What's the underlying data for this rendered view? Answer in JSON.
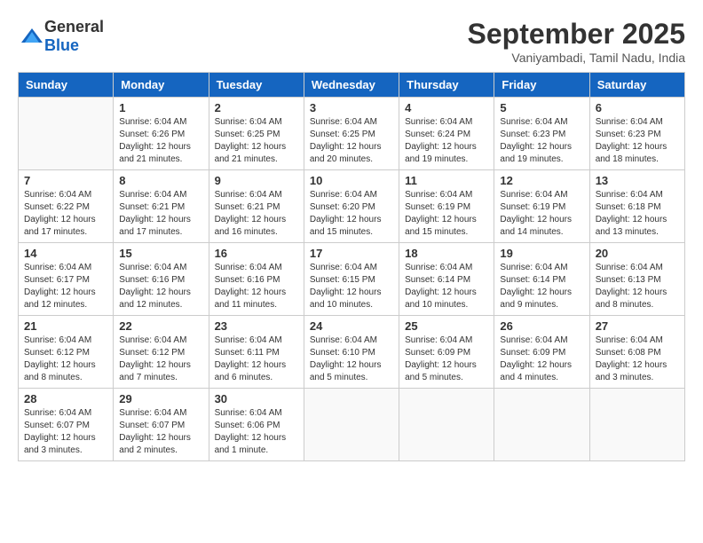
{
  "header": {
    "logo_general": "General",
    "logo_blue": "Blue",
    "month_title": "September 2025",
    "subtitle": "Vaniyambadi, Tamil Nadu, India"
  },
  "calendar": {
    "days_of_week": [
      "Sunday",
      "Monday",
      "Tuesday",
      "Wednesday",
      "Thursday",
      "Friday",
      "Saturday"
    ],
    "weeks": [
      [
        {
          "day": "",
          "info": ""
        },
        {
          "day": "1",
          "info": "Sunrise: 6:04 AM\nSunset: 6:26 PM\nDaylight: 12 hours\nand 21 minutes."
        },
        {
          "day": "2",
          "info": "Sunrise: 6:04 AM\nSunset: 6:25 PM\nDaylight: 12 hours\nand 21 minutes."
        },
        {
          "day": "3",
          "info": "Sunrise: 6:04 AM\nSunset: 6:25 PM\nDaylight: 12 hours\nand 20 minutes."
        },
        {
          "day": "4",
          "info": "Sunrise: 6:04 AM\nSunset: 6:24 PM\nDaylight: 12 hours\nand 19 minutes."
        },
        {
          "day": "5",
          "info": "Sunrise: 6:04 AM\nSunset: 6:23 PM\nDaylight: 12 hours\nand 19 minutes."
        },
        {
          "day": "6",
          "info": "Sunrise: 6:04 AM\nSunset: 6:23 PM\nDaylight: 12 hours\nand 18 minutes."
        }
      ],
      [
        {
          "day": "7",
          "info": "Sunrise: 6:04 AM\nSunset: 6:22 PM\nDaylight: 12 hours\nand 17 minutes."
        },
        {
          "day": "8",
          "info": "Sunrise: 6:04 AM\nSunset: 6:21 PM\nDaylight: 12 hours\nand 17 minutes."
        },
        {
          "day": "9",
          "info": "Sunrise: 6:04 AM\nSunset: 6:21 PM\nDaylight: 12 hours\nand 16 minutes."
        },
        {
          "day": "10",
          "info": "Sunrise: 6:04 AM\nSunset: 6:20 PM\nDaylight: 12 hours\nand 15 minutes."
        },
        {
          "day": "11",
          "info": "Sunrise: 6:04 AM\nSunset: 6:19 PM\nDaylight: 12 hours\nand 15 minutes."
        },
        {
          "day": "12",
          "info": "Sunrise: 6:04 AM\nSunset: 6:19 PM\nDaylight: 12 hours\nand 14 minutes."
        },
        {
          "day": "13",
          "info": "Sunrise: 6:04 AM\nSunset: 6:18 PM\nDaylight: 12 hours\nand 13 minutes."
        }
      ],
      [
        {
          "day": "14",
          "info": "Sunrise: 6:04 AM\nSunset: 6:17 PM\nDaylight: 12 hours\nand 12 minutes."
        },
        {
          "day": "15",
          "info": "Sunrise: 6:04 AM\nSunset: 6:16 PM\nDaylight: 12 hours\nand 12 minutes."
        },
        {
          "day": "16",
          "info": "Sunrise: 6:04 AM\nSunset: 6:16 PM\nDaylight: 12 hours\nand 11 minutes."
        },
        {
          "day": "17",
          "info": "Sunrise: 6:04 AM\nSunset: 6:15 PM\nDaylight: 12 hours\nand 10 minutes."
        },
        {
          "day": "18",
          "info": "Sunrise: 6:04 AM\nSunset: 6:14 PM\nDaylight: 12 hours\nand 10 minutes."
        },
        {
          "day": "19",
          "info": "Sunrise: 6:04 AM\nSunset: 6:14 PM\nDaylight: 12 hours\nand 9 minutes."
        },
        {
          "day": "20",
          "info": "Sunrise: 6:04 AM\nSunset: 6:13 PM\nDaylight: 12 hours\nand 8 minutes."
        }
      ],
      [
        {
          "day": "21",
          "info": "Sunrise: 6:04 AM\nSunset: 6:12 PM\nDaylight: 12 hours\nand 8 minutes."
        },
        {
          "day": "22",
          "info": "Sunrise: 6:04 AM\nSunset: 6:12 PM\nDaylight: 12 hours\nand 7 minutes."
        },
        {
          "day": "23",
          "info": "Sunrise: 6:04 AM\nSunset: 6:11 PM\nDaylight: 12 hours\nand 6 minutes."
        },
        {
          "day": "24",
          "info": "Sunrise: 6:04 AM\nSunset: 6:10 PM\nDaylight: 12 hours\nand 5 minutes."
        },
        {
          "day": "25",
          "info": "Sunrise: 6:04 AM\nSunset: 6:09 PM\nDaylight: 12 hours\nand 5 minutes."
        },
        {
          "day": "26",
          "info": "Sunrise: 6:04 AM\nSunset: 6:09 PM\nDaylight: 12 hours\nand 4 minutes."
        },
        {
          "day": "27",
          "info": "Sunrise: 6:04 AM\nSunset: 6:08 PM\nDaylight: 12 hours\nand 3 minutes."
        }
      ],
      [
        {
          "day": "28",
          "info": "Sunrise: 6:04 AM\nSunset: 6:07 PM\nDaylight: 12 hours\nand 3 minutes."
        },
        {
          "day": "29",
          "info": "Sunrise: 6:04 AM\nSunset: 6:07 PM\nDaylight: 12 hours\nand 2 minutes."
        },
        {
          "day": "30",
          "info": "Sunrise: 6:04 AM\nSunset: 6:06 PM\nDaylight: 12 hours\nand 1 minute."
        },
        {
          "day": "",
          "info": ""
        },
        {
          "day": "",
          "info": ""
        },
        {
          "day": "",
          "info": ""
        },
        {
          "day": "",
          "info": ""
        }
      ]
    ]
  }
}
